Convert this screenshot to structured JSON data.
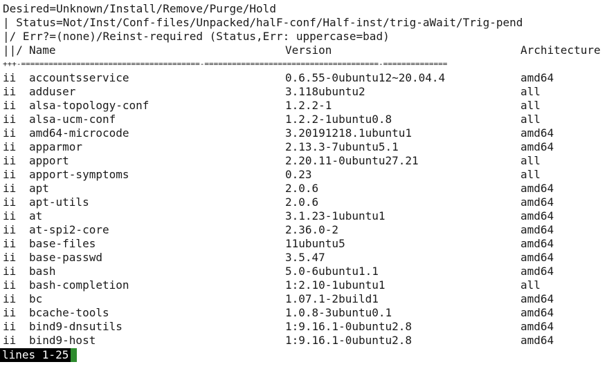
{
  "header": {
    "line1": "Desired=Unknown/Install/Remove/Purge/Hold",
    "line2": "| Status=Not/Inst/Conf-files/Unpacked/halF-conf/Half-inst/trig-aWait/Trig-pend",
    "line3": "|/ Err?=(none)/Reinst-required (Status,Err: uppercase=bad)",
    "col_status": "||/",
    "col_name": "Name",
    "col_version": "Version",
    "col_arch": "Architecture",
    "separator": "+++-=======================================-======================================-=============="
  },
  "packages": [
    {
      "status": "ii",
      "name": "accountsservice",
      "version": "0.6.55-0ubuntu12~20.04.4",
      "arch": "amd64"
    },
    {
      "status": "ii",
      "name": "adduser",
      "version": "3.118ubuntu2",
      "arch": "all"
    },
    {
      "status": "ii",
      "name": "alsa-topology-conf",
      "version": "1.2.2-1",
      "arch": "all"
    },
    {
      "status": "ii",
      "name": "alsa-ucm-conf",
      "version": "1.2.2-1ubuntu0.8",
      "arch": "all"
    },
    {
      "status": "ii",
      "name": "amd64-microcode",
      "version": "3.20191218.1ubuntu1",
      "arch": "amd64"
    },
    {
      "status": "ii",
      "name": "apparmor",
      "version": "2.13.3-7ubuntu5.1",
      "arch": "amd64"
    },
    {
      "status": "ii",
      "name": "apport",
      "version": "2.20.11-0ubuntu27.21",
      "arch": "all"
    },
    {
      "status": "ii",
      "name": "apport-symptoms",
      "version": "0.23",
      "arch": "all"
    },
    {
      "status": "ii",
      "name": "apt",
      "version": "2.0.6",
      "arch": "amd64"
    },
    {
      "status": "ii",
      "name": "apt-utils",
      "version": "2.0.6",
      "arch": "amd64"
    },
    {
      "status": "ii",
      "name": "at",
      "version": "3.1.23-1ubuntu1",
      "arch": "amd64"
    },
    {
      "status": "ii",
      "name": "at-spi2-core",
      "version": "2.36.0-2",
      "arch": "amd64"
    },
    {
      "status": "ii",
      "name": "base-files",
      "version": "11ubuntu5",
      "arch": "amd64"
    },
    {
      "status": "ii",
      "name": "base-passwd",
      "version": "3.5.47",
      "arch": "amd64"
    },
    {
      "status": "ii",
      "name": "bash",
      "version": "5.0-6ubuntu1.1",
      "arch": "amd64"
    },
    {
      "status": "ii",
      "name": "bash-completion",
      "version": "1:2.10-1ubuntu1",
      "arch": "all"
    },
    {
      "status": "ii",
      "name": "bc",
      "version": "1.07.1-2build1",
      "arch": "amd64"
    },
    {
      "status": "ii",
      "name": "bcache-tools",
      "version": "1.0.8-3ubuntu0.1",
      "arch": "amd64"
    },
    {
      "status": "ii",
      "name": "bind9-dnsutils",
      "version": "1:9.16.1-0ubuntu2.8",
      "arch": "amd64"
    },
    {
      "status": "ii",
      "name": "bind9-host",
      "version": "1:9.16.1-0ubuntu2.8",
      "arch": "amd64"
    }
  ],
  "pager": {
    "status": "lines 1-25"
  },
  "colors": {
    "background": "#ffffff",
    "text": "#1a1a1a",
    "pager_bg": "#000000",
    "pager_fg": "#ffffff",
    "cursor": "#2e8b2e"
  }
}
